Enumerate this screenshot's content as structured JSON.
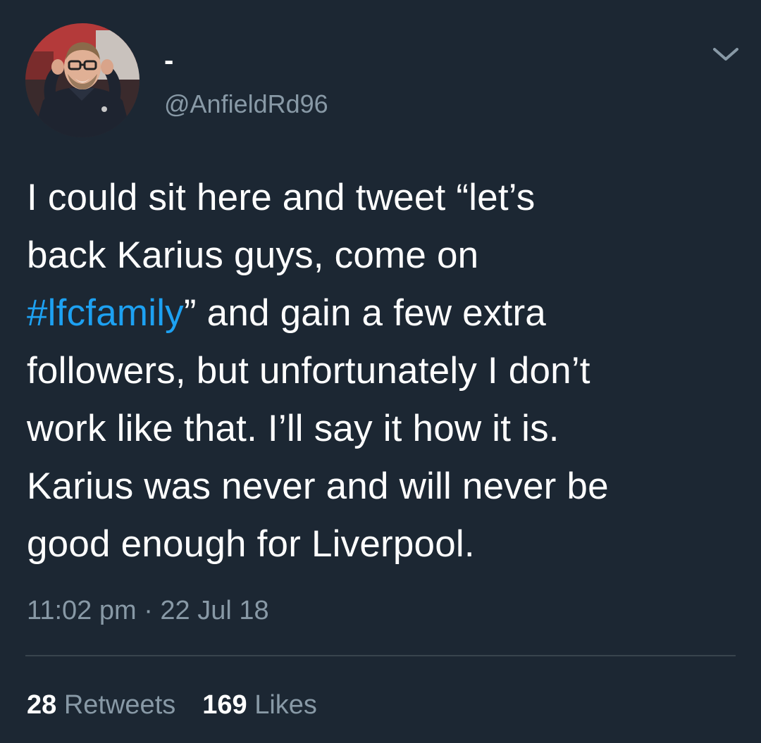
{
  "tweet": {
    "display_name": "-",
    "handle": "@AnfieldRd96",
    "text_segments": {
      "line_a": "I could sit here and tweet “let’s",
      "line_b": "back Karius guys, come on",
      "hashtag": "#lfcfamily",
      "line_c_rest": "” and gain a few extra",
      "line_d": "followers, but unfortunately I don’t",
      "line_e": "work like that. I’ll say it how it is.",
      "line_f": "Karius was never and will never be",
      "line_g": "good enough for Liverpool."
    },
    "time": "11:02 pm",
    "separator": "·",
    "date": "22 Jul 18",
    "retweets_count": "28",
    "retweets_label": "Retweets",
    "likes_count": "169",
    "likes_label": "Likes"
  },
  "icons": {
    "avatar": "avatar-photo",
    "menu": "chevron-down-icon"
  },
  "colors": {
    "background": "#1c2733",
    "text": "#ffffff",
    "secondary": "#8899a6",
    "link": "#1da1f2",
    "divider": "#38444d"
  }
}
